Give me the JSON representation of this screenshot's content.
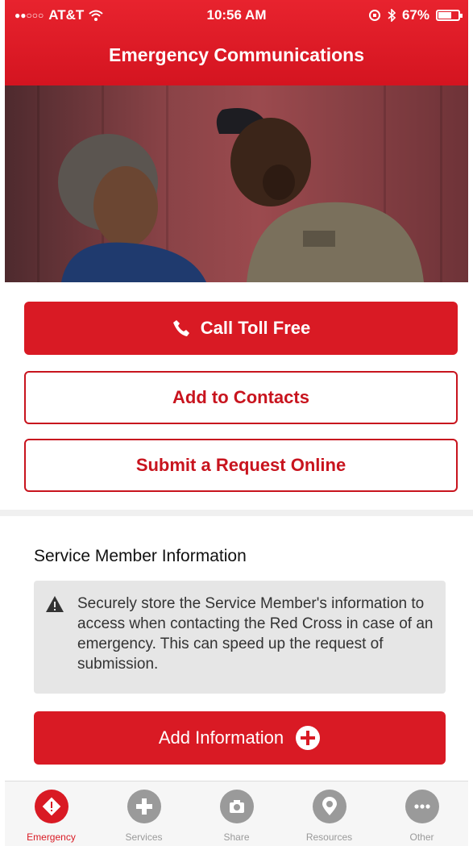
{
  "status_bar": {
    "carrier": "AT&T",
    "time": "10:56 AM",
    "battery": "67%",
    "battery_level": 0.67
  },
  "nav": {
    "title": "Emergency Communications"
  },
  "hero": {
    "icon": "photo-soldier-and-woman"
  },
  "actions": {
    "call_label": "Call Toll Free",
    "contacts_label": "Add to Contacts",
    "submit_label": "Submit a Request Online"
  },
  "service_member": {
    "title": "Service Member Information",
    "notice": "Securely store the Service Member's information to access when contacting the Red Cross in case of an emergency. This can speed up the request of submission.",
    "add_label": "Add Information"
  },
  "tabs": [
    {
      "label": "Emergency",
      "icon": "alert-diamond-icon",
      "active": true
    },
    {
      "label": "Services",
      "icon": "plus-icon",
      "active": false
    },
    {
      "label": "Share",
      "icon": "camera-icon",
      "active": false
    },
    {
      "label": "Resources",
      "icon": "map-pin-icon",
      "active": false
    },
    {
      "label": "Other",
      "icon": "ellipsis-icon",
      "active": false
    }
  ],
  "colors": {
    "brand_red": "#d91a24",
    "inactive_gray": "#9a9a9a"
  }
}
